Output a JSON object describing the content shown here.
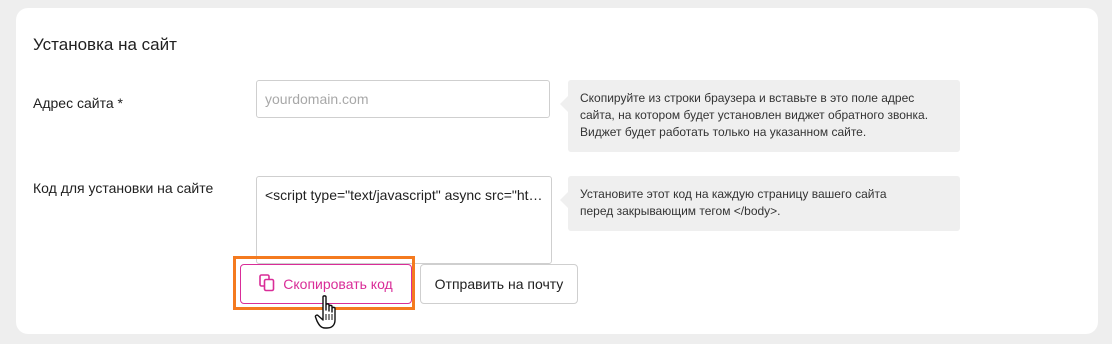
{
  "section": {
    "title": "Установка на сайт"
  },
  "site_address": {
    "label": "Адрес сайта *",
    "placeholder": "yourdomain.com",
    "hint_lines": [
      "Скопируйте из строки браузера и вставьте в это поле адрес",
      "сайта, на котором будет установлен виджет обратного звонка.",
      "Виджет будет работать только на указанном сайте."
    ]
  },
  "install_code": {
    "label": "Код для установки на сайте",
    "value": "<script type=\"text/javascript\" async src=\"https://...",
    "hint_lines": [
      "Установите этот код на каждую страницу вашего сайта",
      "перед закрывающим тегом </body>."
    ]
  },
  "buttons": {
    "copy_label": "Скопировать код",
    "email_label": "Отправить на почту"
  },
  "icons": {
    "copy": "copy-icon",
    "cursor": "hand-pointer-icon"
  },
  "colors": {
    "accent": "#d92d98",
    "highlight": "#f47a1f"
  }
}
